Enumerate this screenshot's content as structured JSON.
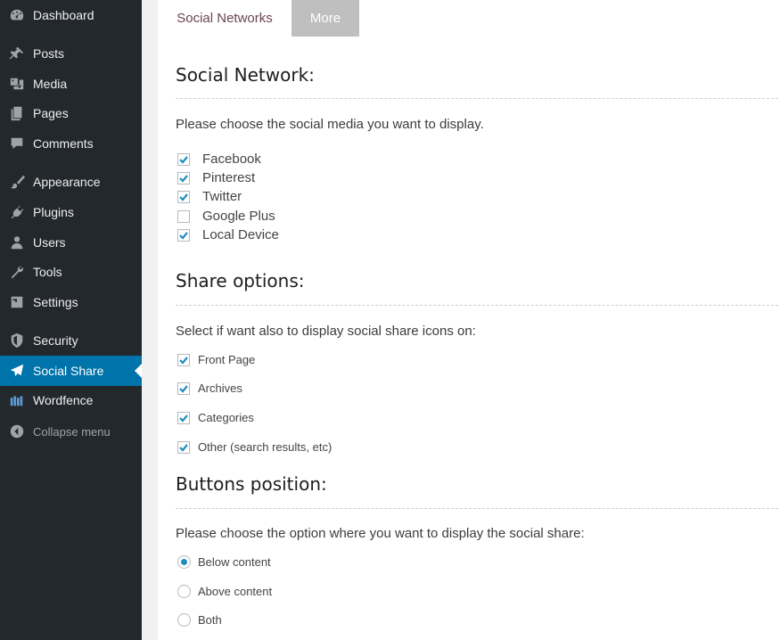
{
  "sidebar": {
    "items": [
      {
        "label": "Dashboard",
        "icon": "dashboard-icon"
      },
      {
        "label": "Posts",
        "icon": "pin-icon"
      },
      {
        "label": "Media",
        "icon": "media-icon"
      },
      {
        "label": "Pages",
        "icon": "pages-icon"
      },
      {
        "label": "Comments",
        "icon": "comment-icon"
      },
      {
        "label": "Appearance",
        "icon": "brush-icon"
      },
      {
        "label": "Plugins",
        "icon": "plug-icon"
      },
      {
        "label": "Users",
        "icon": "user-icon"
      },
      {
        "label": "Tools",
        "icon": "wrench-icon"
      },
      {
        "label": "Settings",
        "icon": "settings-icon"
      },
      {
        "label": "Security",
        "icon": "shield-icon"
      },
      {
        "label": "Social Share",
        "icon": "send-icon",
        "active": true
      },
      {
        "label": "Wordfence",
        "icon": "wordfence-icon"
      }
    ],
    "collapse_label": "Collapse menu",
    "accent_color": "#0073aa"
  },
  "tabs": [
    {
      "label": "Social Networks",
      "active": true
    },
    {
      "label": "More",
      "active": false
    }
  ],
  "social_network": {
    "title": "Social Network:",
    "description": "Please choose the social media you want to display.",
    "options": [
      {
        "label": "Facebook",
        "checked": true
      },
      {
        "label": "Pinterest",
        "checked": true
      },
      {
        "label": "Twitter",
        "checked": true
      },
      {
        "label": "Google Plus",
        "checked": false
      },
      {
        "label": "Local Device",
        "checked": true
      }
    ]
  },
  "share_options": {
    "title": "Share options:",
    "description": "Select if want also to display social share icons on:",
    "options": [
      {
        "label": "Front Page",
        "checked": true
      },
      {
        "label": "Archives",
        "checked": true
      },
      {
        "label": "Categories",
        "checked": true
      },
      {
        "label": "Other (search results, etc)",
        "checked": true
      }
    ]
  },
  "buttons_position": {
    "title": "Buttons position:",
    "description": "Please choose the option where you want to display the social share:",
    "options": [
      {
        "label": "Below content",
        "selected": true
      },
      {
        "label": "Above content",
        "selected": false
      },
      {
        "label": "Both",
        "selected": false
      }
    ]
  }
}
